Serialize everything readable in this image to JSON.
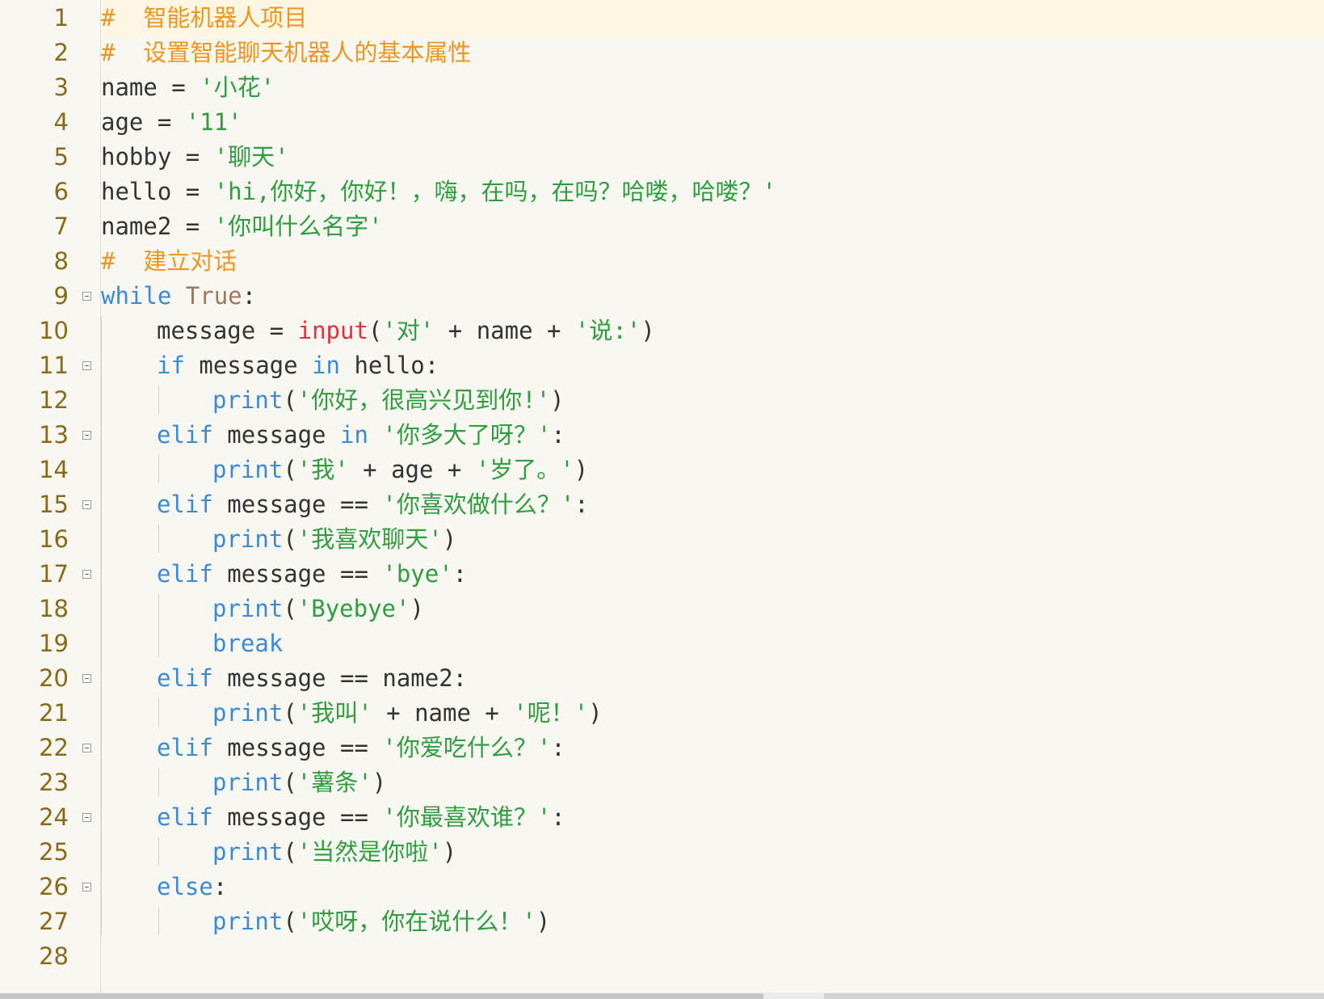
{
  "editor": {
    "colors": {
      "background": "#f8f7f2",
      "line_number": "#8a6a16",
      "keyword": "#3b8ad6",
      "builtin_input": "#e0323c",
      "constant": "#a0785a",
      "string": "#2e9e3e",
      "comment": "#f0961e",
      "plain": "#333333",
      "current_line": "#fdf6e3"
    },
    "line_numbers": [
      "1",
      "2",
      "3",
      "4",
      "5",
      "6",
      "7",
      "8",
      "9",
      "10",
      "11",
      "12",
      "13",
      "14",
      "15",
      "16",
      "17",
      "18",
      "19",
      "20",
      "21",
      "22",
      "23",
      "24",
      "25",
      "26",
      "27",
      "28"
    ],
    "lines": [
      {
        "indent": 0,
        "tokens": [
          {
            "t": "#  智能机器人项目",
            "c": "cm"
          }
        ]
      },
      {
        "indent": 0,
        "tokens": [
          {
            "t": "#  设置智能聊天机器人的基本属性",
            "c": "cm"
          }
        ]
      },
      {
        "indent": 0,
        "tokens": [
          {
            "t": "name = ",
            "c": "pl"
          },
          {
            "t": "'小花'",
            "c": "str"
          }
        ]
      },
      {
        "indent": 0,
        "tokens": [
          {
            "t": "age = ",
            "c": "pl"
          },
          {
            "t": "'11'",
            "c": "str"
          }
        ]
      },
      {
        "indent": 0,
        "tokens": [
          {
            "t": "hobby = ",
            "c": "pl"
          },
          {
            "t": "'聊天'",
            "c": "str"
          }
        ]
      },
      {
        "indent": 0,
        "tokens": [
          {
            "t": "hello = ",
            "c": "pl"
          },
          {
            "t": "'hi,你好，你好！，嗨，在吗，在吗？哈喽，哈喽？'",
            "c": "str"
          }
        ]
      },
      {
        "indent": 0,
        "tokens": [
          {
            "t": "name2 = ",
            "c": "pl"
          },
          {
            "t": "'你叫什么名字'",
            "c": "str"
          }
        ]
      },
      {
        "indent": 0,
        "tokens": [
          {
            "t": "#  建立对话",
            "c": "cm"
          }
        ]
      },
      {
        "indent": 0,
        "fold": true,
        "tokens": [
          {
            "t": "while",
            "c": "kw"
          },
          {
            "t": " ",
            "c": "pl"
          },
          {
            "t": "True",
            "c": "cst"
          },
          {
            "t": ":",
            "c": "pl"
          }
        ]
      },
      {
        "indent": 1,
        "tokens": [
          {
            "t": "message = ",
            "c": "pl"
          },
          {
            "t": "input",
            "c": "bi"
          },
          {
            "t": "(",
            "c": "pl"
          },
          {
            "t": "'对'",
            "c": "str"
          },
          {
            "t": " + name + ",
            "c": "pl"
          },
          {
            "t": "'说:'",
            "c": "str"
          },
          {
            "t": ")",
            "c": "pl"
          }
        ]
      },
      {
        "indent": 1,
        "fold": true,
        "tokens": [
          {
            "t": "if",
            "c": "kw"
          },
          {
            "t": " message ",
            "c": "pl"
          },
          {
            "t": "in",
            "c": "kw"
          },
          {
            "t": " hello:",
            "c": "pl"
          }
        ]
      },
      {
        "indent": 2,
        "tokens": [
          {
            "t": "print",
            "c": "kw"
          },
          {
            "t": "(",
            "c": "pl"
          },
          {
            "t": "'你好，很高兴见到你!'",
            "c": "str"
          },
          {
            "t": ")",
            "c": "pl"
          }
        ]
      },
      {
        "indent": 1,
        "fold": true,
        "tokens": [
          {
            "t": "elif",
            "c": "kw"
          },
          {
            "t": " message ",
            "c": "pl"
          },
          {
            "t": "in",
            "c": "kw"
          },
          {
            "t": " ",
            "c": "pl"
          },
          {
            "t": "'你多大了呀？'",
            "c": "str"
          },
          {
            "t": ":",
            "c": "pl"
          }
        ]
      },
      {
        "indent": 2,
        "tokens": [
          {
            "t": "print",
            "c": "kw"
          },
          {
            "t": "(",
            "c": "pl"
          },
          {
            "t": "'我'",
            "c": "str"
          },
          {
            "t": " + age + ",
            "c": "pl"
          },
          {
            "t": "'岁了。'",
            "c": "str"
          },
          {
            "t": ")",
            "c": "pl"
          }
        ]
      },
      {
        "indent": 1,
        "fold": true,
        "tokens": [
          {
            "t": "elif",
            "c": "kw"
          },
          {
            "t": " message == ",
            "c": "pl"
          },
          {
            "t": "'你喜欢做什么？'",
            "c": "str"
          },
          {
            "t": ":",
            "c": "pl"
          }
        ]
      },
      {
        "indent": 2,
        "tokens": [
          {
            "t": "print",
            "c": "kw"
          },
          {
            "t": "(",
            "c": "pl"
          },
          {
            "t": "'我喜欢聊天'",
            "c": "str"
          },
          {
            "t": ")",
            "c": "pl"
          }
        ]
      },
      {
        "indent": 1,
        "fold": true,
        "tokens": [
          {
            "t": "elif",
            "c": "kw"
          },
          {
            "t": " message == ",
            "c": "pl"
          },
          {
            "t": "'bye'",
            "c": "str"
          },
          {
            "t": ":",
            "c": "pl"
          }
        ]
      },
      {
        "indent": 2,
        "tokens": [
          {
            "t": "print",
            "c": "kw"
          },
          {
            "t": "(",
            "c": "pl"
          },
          {
            "t": "'Byebye'",
            "c": "str"
          },
          {
            "t": ")",
            "c": "pl"
          }
        ]
      },
      {
        "indent": 2,
        "tokens": [
          {
            "t": "break",
            "c": "kw"
          }
        ]
      },
      {
        "indent": 1,
        "fold": true,
        "tokens": [
          {
            "t": "elif",
            "c": "kw"
          },
          {
            "t": " message == name2:",
            "c": "pl"
          }
        ]
      },
      {
        "indent": 2,
        "tokens": [
          {
            "t": "print",
            "c": "kw"
          },
          {
            "t": "(",
            "c": "pl"
          },
          {
            "t": "'我叫'",
            "c": "str"
          },
          {
            "t": " + name + ",
            "c": "pl"
          },
          {
            "t": "'呢！'",
            "c": "str"
          },
          {
            "t": ")",
            "c": "pl"
          }
        ]
      },
      {
        "indent": 1,
        "fold": true,
        "tokens": [
          {
            "t": "elif",
            "c": "kw"
          },
          {
            "t": " message == ",
            "c": "pl"
          },
          {
            "t": "'你爱吃什么？'",
            "c": "str"
          },
          {
            "t": ":",
            "c": "pl"
          }
        ]
      },
      {
        "indent": 2,
        "tokens": [
          {
            "t": "print",
            "c": "kw"
          },
          {
            "t": "(",
            "c": "pl"
          },
          {
            "t": "'薯条'",
            "c": "str"
          },
          {
            "t": ")",
            "c": "pl"
          }
        ]
      },
      {
        "indent": 1,
        "fold": true,
        "tokens": [
          {
            "t": "elif",
            "c": "kw"
          },
          {
            "t": " message == ",
            "c": "pl"
          },
          {
            "t": "'你最喜欢谁？'",
            "c": "str"
          },
          {
            "t": ":",
            "c": "pl"
          }
        ]
      },
      {
        "indent": 2,
        "tokens": [
          {
            "t": "print",
            "c": "kw"
          },
          {
            "t": "(",
            "c": "pl"
          },
          {
            "t": "'当然是你啦'",
            "c": "str"
          },
          {
            "t": ")",
            "c": "pl"
          }
        ]
      },
      {
        "indent": 1,
        "fold": true,
        "tokens": [
          {
            "t": "else",
            "c": "kw"
          },
          {
            "t": ":",
            "c": "pl"
          }
        ]
      },
      {
        "indent": 2,
        "tokens": [
          {
            "t": "print",
            "c": "kw"
          },
          {
            "t": "(",
            "c": "pl"
          },
          {
            "t": "'哎呀，你在说什么！'",
            "c": "str"
          },
          {
            "t": ")",
            "c": "pl"
          }
        ]
      }
    ]
  }
}
